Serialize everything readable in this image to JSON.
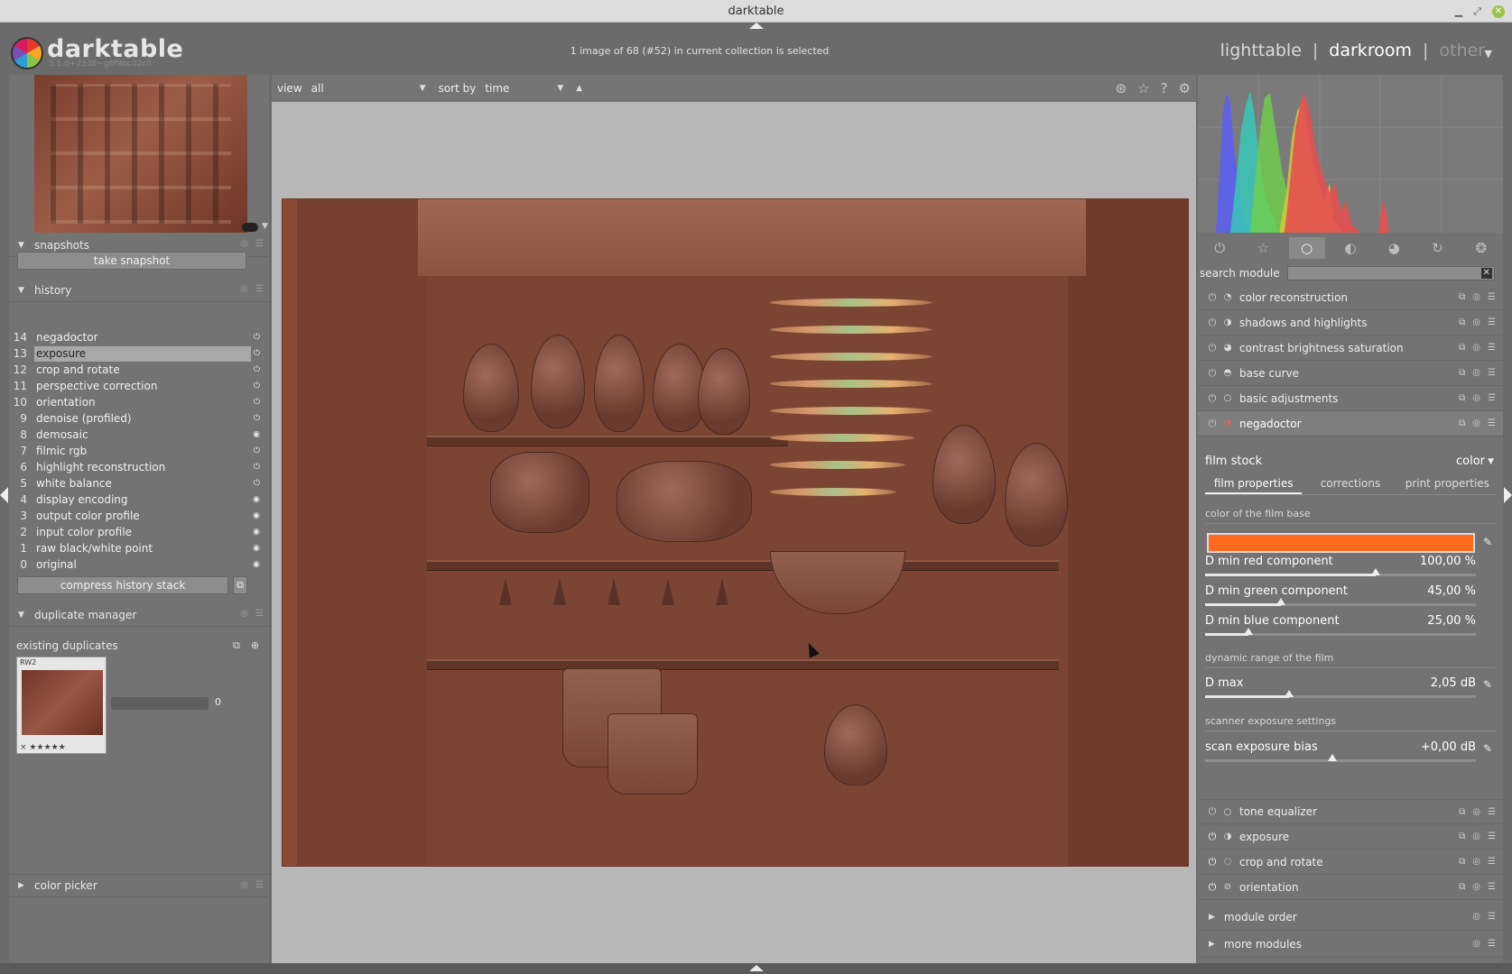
{
  "window": {
    "title": "darktable"
  },
  "header": {
    "logo_text": "darktable",
    "version": "3.1.0+2338~g6f9bc02c8",
    "status": "1 image of 68 (#52) in current collection is selected",
    "views": {
      "lighttable": "lighttable",
      "sep1": "|",
      "darkroom": "darkroom",
      "sep2": "|",
      "other": "other"
    }
  },
  "left": {
    "snapshots": {
      "title": "snapshots",
      "take_snapshot": "take snapshot"
    },
    "history": {
      "title": "history",
      "items": [
        {
          "n": "14",
          "label": "negadoctor"
        },
        {
          "n": "13",
          "label": "exposure"
        },
        {
          "n": "12",
          "label": "crop and rotate"
        },
        {
          "n": "11",
          "label": "perspective correction"
        },
        {
          "n": "10",
          "label": "orientation"
        },
        {
          "n": "9",
          "label": "denoise (profiled)"
        },
        {
          "n": "8",
          "label": "demosaic"
        },
        {
          "n": "7",
          "label": "filmic rgb"
        },
        {
          "n": "6",
          "label": "highlight reconstruction"
        },
        {
          "n": "5",
          "label": "white balance"
        },
        {
          "n": "4",
          "label": "display encoding"
        },
        {
          "n": "3",
          "label": "output color profile"
        },
        {
          "n": "2",
          "label": "input color profile"
        },
        {
          "n": "1",
          "label": "raw black/white point"
        },
        {
          "n": "0",
          "label": "original"
        }
      ],
      "compress": "compress history stack"
    },
    "duplicate_manager": {
      "title": "duplicate manager",
      "existing": "existing duplicates",
      "thumb_tag": "RW2",
      "thumb_stars": "× ★★★★★",
      "version_num": "0"
    },
    "color_picker": {
      "title": "color picker"
    }
  },
  "filter": {
    "view_label": "view",
    "view_value": "all",
    "sort_label": "sort by",
    "sort_value": "time"
  },
  "right": {
    "search_label": "search module",
    "modules_top": [
      {
        "name": "color reconstruction"
      },
      {
        "name": "shadows and highlights"
      },
      {
        "name": "contrast brightness saturation"
      },
      {
        "name": "base curve"
      },
      {
        "name": "basic adjustments"
      },
      {
        "name": "negadoctor"
      }
    ],
    "negadoctor": {
      "film_stock_label": "film stock",
      "film_stock_value": "color",
      "tabs": [
        "film properties",
        "corrections",
        "print properties"
      ],
      "sec_film_base": "color of the film base",
      "film_base_color": "#fe6a1f",
      "dmin_red": {
        "label": "D min red component",
        "value": "100,00 %",
        "fraction": 0.63
      },
      "dmin_green": {
        "label": "D min green component",
        "value": "45,00 %",
        "fraction": 0.28
      },
      "dmin_blue": {
        "label": "D min blue component",
        "value": "25,00 %",
        "fraction": 0.16
      },
      "sec_dynamic": "dynamic range of the film",
      "dmax": {
        "label": "D max",
        "value": "2,05 dB",
        "fraction": 0.31
      },
      "sec_scanner": "scanner exposure settings",
      "scan_bias": {
        "label": "scan exposure bias",
        "value": "+0,00 dB",
        "fraction": 0.47
      }
    },
    "modules_bottom": [
      {
        "name": "tone equalizer"
      },
      {
        "name": "exposure"
      },
      {
        "name": "crop and rotate"
      },
      {
        "name": "orientation"
      }
    ],
    "module_order": "module order",
    "more_modules": "more modules"
  }
}
